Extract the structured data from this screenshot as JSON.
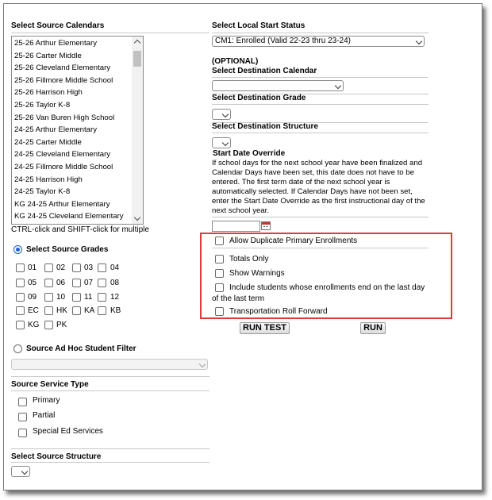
{
  "left": {
    "source_calendars": {
      "header": "Select Source Calendars",
      "items": [
        "25-26 Arthur Elementary",
        "25-26 Carter Middle",
        "25-26 Cleveland Elementary",
        "25-26 Fillmore Middle School",
        "25-26 Harrison High",
        "25-26 Taylor K-8",
        "25-26 Van Buren High School",
        "24-25 Arthur Elementary",
        "24-25 Carter Middle",
        "24-25 Cleveland Elementary",
        "24-25 Fillmore Middle School",
        "24-25 Harrison High",
        "24-25 Taylor K-8",
        "KG 24-25 Arthur Elementary",
        "KG 24-25 Cleveland Elementary"
      ],
      "hint": "CTRL-click and SHIFT-click for multiple"
    },
    "source_grades": {
      "label": "Select Source Grades",
      "grades": [
        "01",
        "02",
        "03",
        "04",
        "05",
        "06",
        "07",
        "08",
        "09",
        "10",
        "11",
        "12",
        "EC",
        "HK",
        "KA",
        "KB",
        "KG",
        "PK"
      ]
    },
    "ad_hoc": {
      "label": "Source Ad Hoc Student Filter"
    },
    "service_type": {
      "header": "Source Service Type",
      "options": [
        "Primary",
        "Partial",
        "Special Ed Services"
      ]
    },
    "source_structure": {
      "header": "Select Source Structure"
    }
  },
  "right": {
    "start_status": {
      "header": "Select Local Start Status",
      "selected": "CM1: Enrolled (Valid 22-23 thru 23-24)"
    },
    "destination_calendar": {
      "optional": "(OPTIONAL)",
      "header": "Select Destination Calendar"
    },
    "destination_grade": {
      "header": "Select Destination Grade"
    },
    "destination_structure": {
      "header": "Select Destination Structure"
    },
    "start_date_override": {
      "header": "Start Date Override",
      "description": "If school days for the next school year have been finalized and Calendar Days have been set, this date does not have to be entered. The first term date of the next school year is automatically selected. If Calendar Days have not been set, enter the Start Date Override as the first instructional day of the next school year."
    },
    "options": {
      "allow_duplicate": "Allow Duplicate Primary Enrollments",
      "totals_only": "Totals Only",
      "show_warnings": "Show Warnings",
      "include_ending": "Include students whose enrollments end on the last day of the last term",
      "transportation": "Transportation Roll Forward"
    },
    "buttons": {
      "run_test": "RUN TEST",
      "run": "RUN"
    }
  },
  "colors": {
    "highlight": "#e03c3c",
    "radio_accent": "#1a5fd0"
  },
  "icons": [
    "calendar-icon",
    "chevron-down-icon",
    "scroll-up-icon",
    "scroll-down-icon"
  ]
}
